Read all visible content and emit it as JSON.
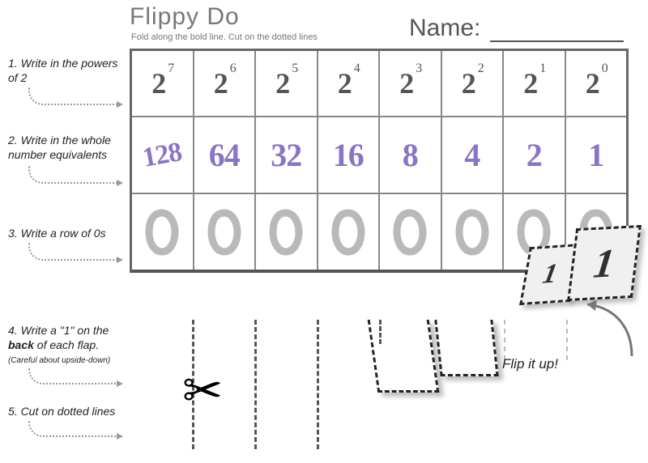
{
  "header": {
    "title": "Flippy Do",
    "subtitle": "Fold along the bold line.  Cut on the dotted lines",
    "name_label": "Name:"
  },
  "instructions": {
    "i1": "1. Write in the powers of 2",
    "i2": "2. Write in the whole number equivalents",
    "i3": "3. Write a row of 0s",
    "i4_a": "4. Write a \"1\" on the ",
    "i4_b": "back",
    "i4_c": " of each flap.",
    "i4_note": "(Careful about upside-down)",
    "i5": "5. Cut on dotted lines"
  },
  "powers": {
    "base": "2",
    "exps": [
      "7",
      "6",
      "5",
      "4",
      "3",
      "2",
      "1",
      "0"
    ]
  },
  "equivalents": [
    "128",
    "64",
    "32",
    "16",
    "8",
    "4",
    "2",
    "1"
  ],
  "zeros": [
    "0",
    "0",
    "0",
    "0",
    "0",
    "0",
    "0",
    "0"
  ],
  "flap": {
    "one_small": "1",
    "one_big": "1",
    "flip_label": "Flip it up!"
  }
}
